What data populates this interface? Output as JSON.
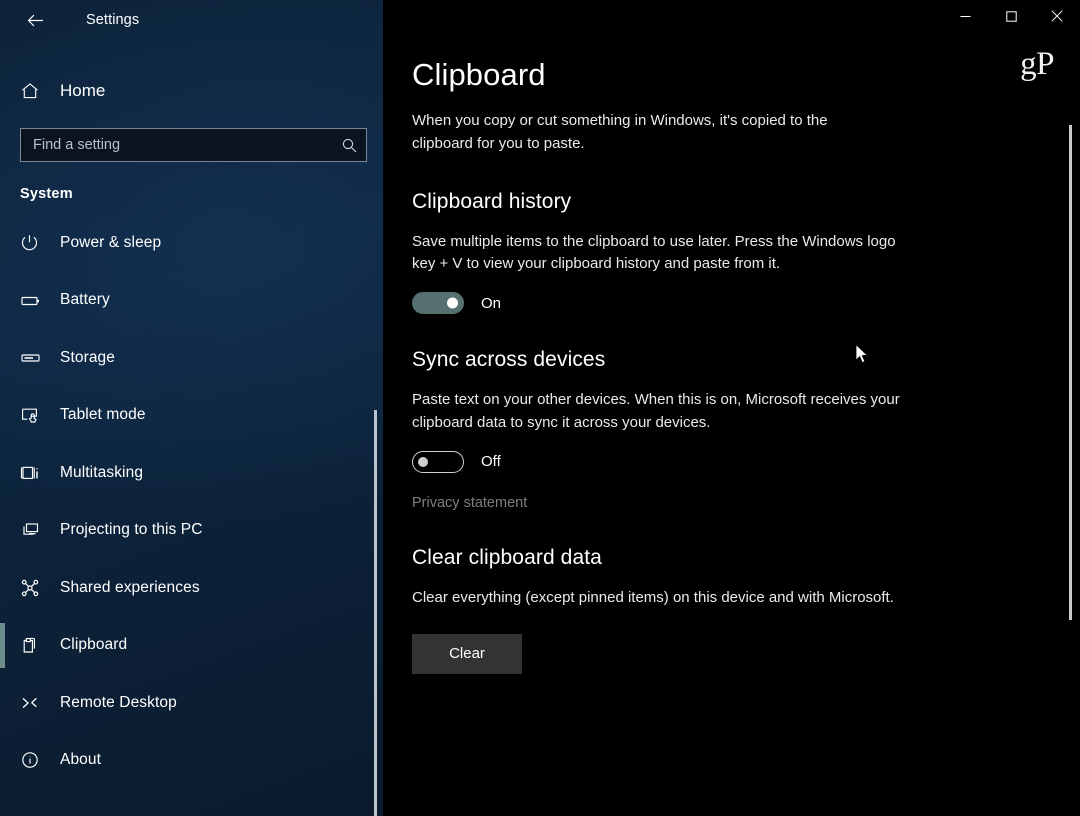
{
  "window": {
    "title": "Settings",
    "back_icon": "back-arrow-icon",
    "minimize_label": "Minimize",
    "maximize_label": "Maximize",
    "close_label": "Close",
    "watermark": "gP"
  },
  "sidebar": {
    "home": {
      "label": "Home",
      "icon": "home-icon"
    },
    "search": {
      "placeholder": "Find a setting",
      "value": "",
      "icon": "search-icon"
    },
    "group_heading": "System",
    "items": [
      {
        "label": "Power & sleep",
        "icon": "power-icon",
        "selected": false
      },
      {
        "label": "Battery",
        "icon": "battery-icon",
        "selected": false
      },
      {
        "label": "Storage",
        "icon": "storage-icon",
        "selected": false
      },
      {
        "label": "Tablet mode",
        "icon": "tablet-icon",
        "selected": false
      },
      {
        "label": "Multitasking",
        "icon": "multitasking-icon",
        "selected": false
      },
      {
        "label": "Projecting to this PC",
        "icon": "projecting-icon",
        "selected": false
      },
      {
        "label": "Shared experiences",
        "icon": "share-icon",
        "selected": false
      },
      {
        "label": "Clipboard",
        "icon": "clipboard-icon",
        "selected": true
      },
      {
        "label": "Remote Desktop",
        "icon": "remote-desktop-icon",
        "selected": false
      },
      {
        "label": "About",
        "icon": "info-icon",
        "selected": false
      }
    ]
  },
  "main": {
    "title": "Clipboard",
    "description": "When you copy or cut something in Windows, it's copied to the clipboard for you to paste.",
    "sections": [
      {
        "heading": "Clipboard history",
        "description": "Save multiple items to the clipboard to use later. Press the Windows logo key + V to view your clipboard history and paste from it.",
        "toggle_state": "On",
        "toggle_on": true
      },
      {
        "heading": "Sync across devices",
        "description": "Paste text on your other devices. When this is on, Microsoft receives your clipboard data to sync it across your devices.",
        "toggle_state": "Off",
        "toggle_on": false,
        "link": "Privacy statement"
      },
      {
        "heading": "Clear clipboard data",
        "description": "Clear everything (except pinned items) on this device and with Microsoft.",
        "button": "Clear"
      }
    ]
  },
  "colors": {
    "accent_toggle_on": "#567070",
    "selection_indicator": "#6d8c8c",
    "sidebar_bg": "#0d2239",
    "main_bg": "#000000",
    "button_bg": "#333333",
    "link": "#7e7e7e"
  }
}
